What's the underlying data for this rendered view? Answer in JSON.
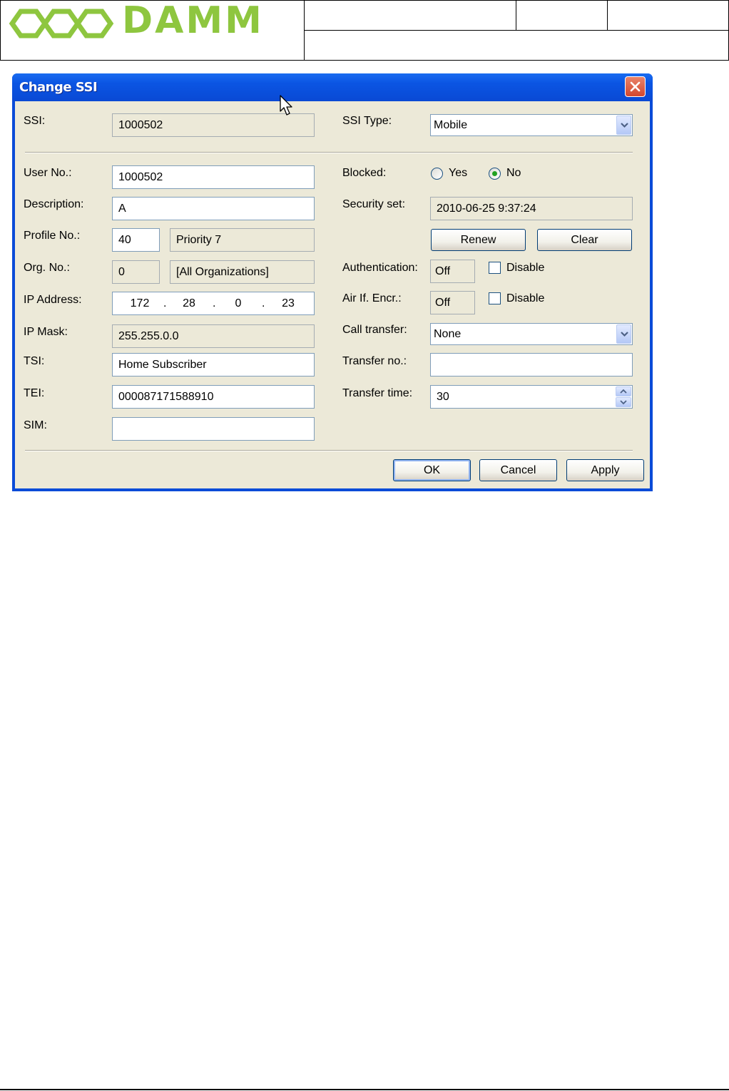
{
  "header": {
    "logo_text": "DAMM",
    "brand_color": "#8ec63f"
  },
  "dialog": {
    "title": "Change SSI",
    "close_icon": "close-icon"
  },
  "fields": {
    "ssi": {
      "label": "SSI:",
      "value": "1000502"
    },
    "ssi_type": {
      "label": "SSI Type:",
      "value": "Mobile"
    },
    "user_no": {
      "label": "User No.:",
      "value": "1000502"
    },
    "description": {
      "label": "Description:",
      "value": "A"
    },
    "profile_no": {
      "label": "Profile No.:",
      "value": "40",
      "profile_name": "Priority 7"
    },
    "org_no": {
      "label": "Org. No.:",
      "value": "0",
      "org_name": "[All Organizations]"
    },
    "ip_address": {
      "label": "IP Address:",
      "parts": [
        "172",
        "28",
        "0",
        "23"
      ],
      "separator": "."
    },
    "ip_mask": {
      "label": "IP Mask:",
      "value": "255.255.0.0"
    },
    "tsi": {
      "label": "TSI:",
      "value": "Home Subscriber"
    },
    "tei": {
      "label": "TEI:",
      "value": "000087171588910"
    },
    "sim": {
      "label": "SIM:",
      "value": ""
    },
    "blocked": {
      "label": "Blocked:",
      "yes_label": "Yes",
      "no_label": "No",
      "selected": "No"
    },
    "security_set": {
      "label": "Security set:",
      "value": "2010-06-25 9:37:24"
    },
    "authentication": {
      "label": "Authentication:",
      "value": "Off",
      "disable_label": "Disable"
    },
    "air_if_encr": {
      "label": "Air If. Encr.:",
      "value": "Off",
      "disable_label": "Disable"
    },
    "call_transfer": {
      "label": "Call transfer:",
      "value": "None"
    },
    "transfer_no": {
      "label": "Transfer no.:",
      "value": ""
    },
    "transfer_time": {
      "label": "Transfer time:",
      "value": "30"
    }
  },
  "buttons": {
    "renew": "Renew",
    "clear": "Clear",
    "ok": "OK",
    "cancel": "Cancel",
    "apply": "Apply"
  }
}
